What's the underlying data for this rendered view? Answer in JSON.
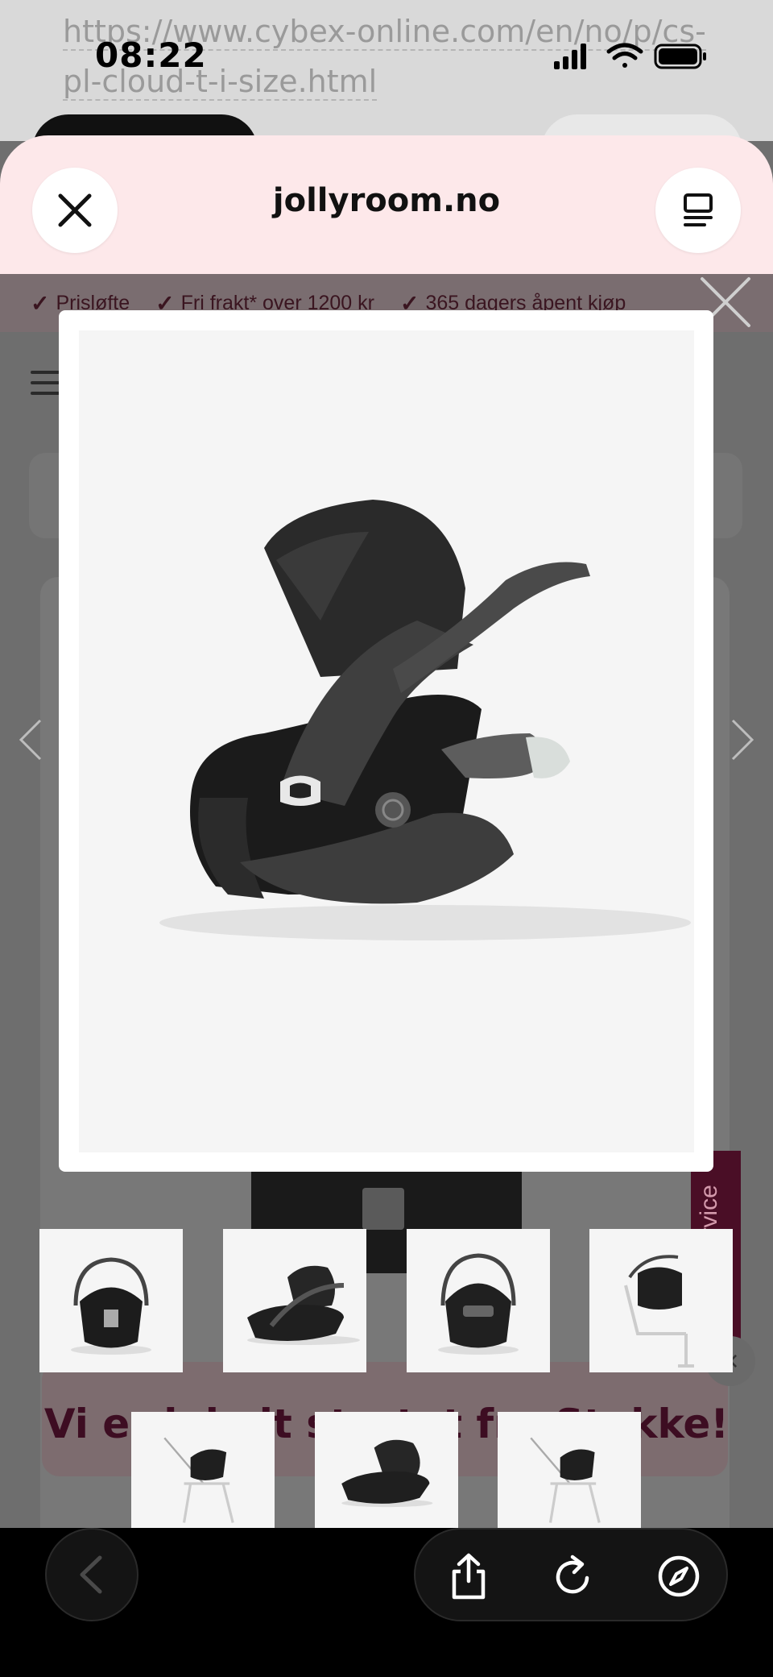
{
  "status_bar": {
    "time": "08:22"
  },
  "background_page": {
    "url_text": "https://www.cybex-online.com/en/no/p/cs-pl-cloud-t-i-size.html",
    "usp_items": [
      "Prisløfte",
      "Fri frakt* over 1200 kr",
      "365 dagers åpent kjøp"
    ],
    "promo_text": "Vi er lokalt startet fra Stokke!",
    "customer_service_label": "Kundeservice"
  },
  "sheet": {
    "title": "jollyroom.no"
  },
  "lightbox": {
    "thumbnails": [
      {
        "name": "front-view"
      },
      {
        "name": "side-view"
      },
      {
        "name": "rear-view"
      },
      {
        "name": "on-base-view"
      },
      {
        "name": "on-stroller-view"
      },
      {
        "name": "side-view-2"
      },
      {
        "name": "on-stroller-view-2"
      }
    ]
  },
  "icons": {
    "close": "close-icon",
    "reader": "reader-icon",
    "prev": "chevron-left-icon",
    "next": "chevron-right-icon",
    "share": "share-icon",
    "reload": "reload-icon",
    "compass": "compass-icon",
    "back": "back-icon"
  },
  "colors": {
    "sheet_header": "#fde8ea",
    "brand_maroon": "#4a0e26",
    "toolbar": "#000000"
  }
}
